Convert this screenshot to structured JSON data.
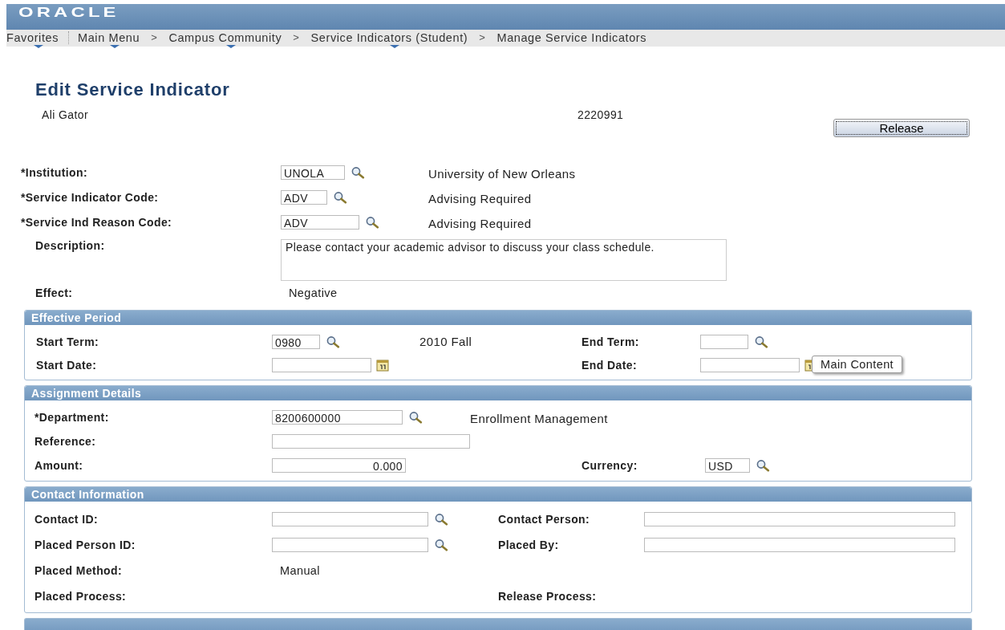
{
  "header": {
    "logo": "ORACLE"
  },
  "nav": [
    {
      "label": "Favorites",
      "menu": true
    },
    {
      "label": "Main Menu",
      "menu": true
    },
    {
      "separator": ">",
      "label": "Campus Community",
      "menu": true
    },
    {
      "separator": ">",
      "label": "Service Indicators (Student)",
      "menu": true
    },
    {
      "separator": ">",
      "label": "Manage Service Indicators",
      "menu": false
    }
  ],
  "page": {
    "title": "Edit Service Indicator",
    "person_name": "Ali Gator",
    "person_id": "2220991",
    "release_button": "Release"
  },
  "top_rows": [
    {
      "label": "*Institution:",
      "field": {
        "kind": "lookup",
        "value": "UNOLA"
      },
      "desc": "University of New Orleans"
    },
    {
      "label": "*Service Indicator Code:",
      "field": {
        "kind": "lookup",
        "value": "ADV"
      },
      "desc": "Advising Required"
    },
    {
      "label": "*Service Ind Reason Code:",
      "field": {
        "kind": "lookup",
        "value": "ADV"
      },
      "desc": "Advising Required"
    },
    {
      "label": "Description:",
      "field": {
        "kind": "textarea",
        "value": "Please contact your academic advisor to discuss your class schedule."
      }
    },
    {
      "label": "Effect:",
      "text": "Negative"
    }
  ],
  "sections": [
    {
      "title": "Effective Period",
      "rows": [
        {
          "label": "Start Term:",
          "field": {
            "kind": "lookup",
            "value": "0980"
          },
          "desc": "2010 Fall",
          "label2": "End Term:",
          "field2": {
            "kind": "lookup"
          }
        },
        {
          "label": "Start Date:",
          "field": {
            "kind": "date"
          },
          "label2": "End Date:",
          "field2": {
            "kind": "date"
          }
        }
      ]
    },
    {
      "title": "Assignment Details",
      "rows": [
        {
          "label": "*Department:",
          "field": {
            "kind": "lookup",
            "value": "8200600000"
          },
          "desc": "Enrollment Management"
        },
        {
          "label": "Reference:",
          "field": {
            "kind": "wide"
          }
        },
        {
          "label": "Amount:",
          "field": {
            "kind": "number",
            "value": "0.000"
          },
          "label2": "Currency:",
          "field2": {
            "kind": "lookup",
            "value": "USD"
          }
        }
      ]
    },
    {
      "title": "Contact Information",
      "rows": [
        {
          "label": "Contact ID:",
          "field": {
            "kind": "lookup"
          },
          "label2": "Contact Person:",
          "field2": {
            "kind": "wide"
          }
        },
        {
          "label": "Placed Person ID:",
          "field": {
            "kind": "lookup"
          },
          "label2": "Placed By:",
          "field2": {
            "kind": "wide"
          }
        },
        {
          "label": "Placed Method:",
          "text": "Manual"
        },
        {
          "label": "Placed Process:",
          "label2": "Release Process:"
        }
      ]
    }
  ],
  "tooltip": "Main Content"
}
